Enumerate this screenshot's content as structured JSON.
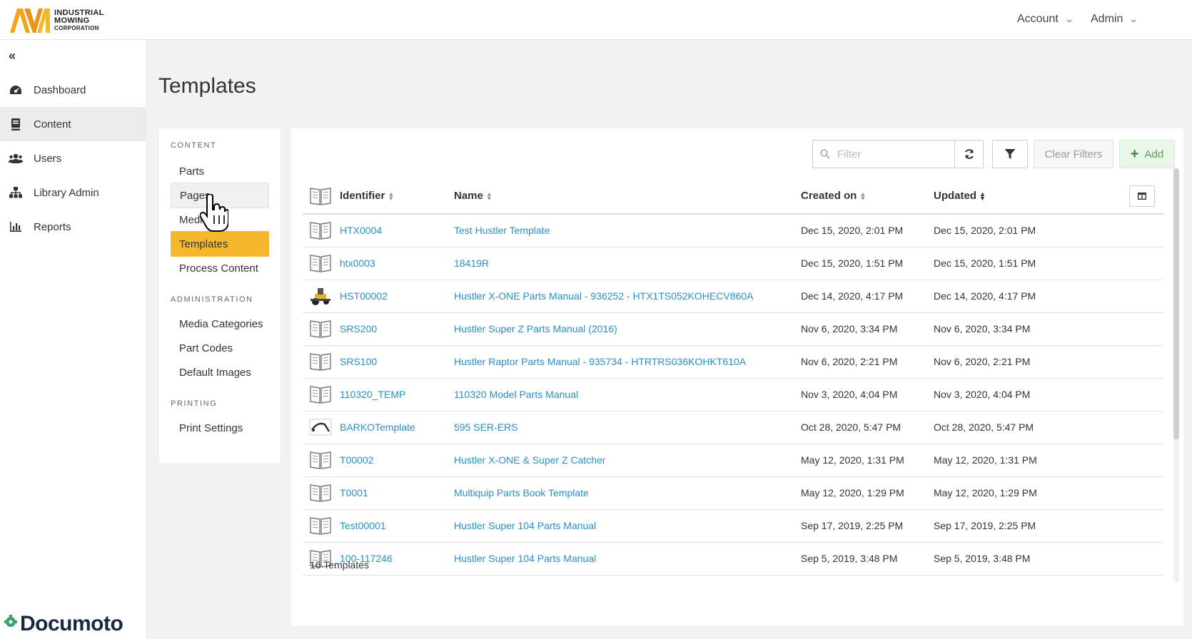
{
  "brand": {
    "company_line1": "INDUSTRIAL",
    "company_line2": "MOWING",
    "company_line3": "CORPORATION",
    "product": "Documoto",
    "accent_color": "#f5b82c",
    "link_color": "#2a8fc7"
  },
  "header": {
    "account_label": "Account",
    "admin_label": "Admin"
  },
  "leftnav": {
    "items": [
      {
        "label": "Dashboard",
        "icon": "dashboard-gauge-icon"
      },
      {
        "label": "Content",
        "icon": "book-icon",
        "active": true
      },
      {
        "label": "Users",
        "icon": "users-icon"
      },
      {
        "label": "Library Admin",
        "icon": "sitemap-icon"
      },
      {
        "label": "Reports",
        "icon": "bar-chart-icon"
      }
    ]
  },
  "page": {
    "title": "Templates"
  },
  "submenu": {
    "content_heading": "CONTENT",
    "content_items": [
      "Parts",
      "Pages",
      "Media",
      "Templates",
      "Process Content"
    ],
    "admin_heading": "ADMINISTRATION",
    "admin_items": [
      "Media Categories",
      "Part Codes",
      "Default Images"
    ],
    "printing_heading": "PRINTING",
    "printing_items": [
      "Print Settings"
    ],
    "active_item": "Templates",
    "hover_item": "Pages"
  },
  "toolbar": {
    "filter_placeholder": "Filter",
    "clear_filters_label": "Clear Filters",
    "add_label": "Add"
  },
  "table": {
    "columns": [
      "Identifier",
      "Name",
      "Created on",
      "Updated"
    ],
    "rows": [
      {
        "thumb": "book-icon",
        "identifier": "HTX0004",
        "name": "Test Hustler Template",
        "created": "Dec 15, 2020, 2:01 PM",
        "updated": "Dec 15, 2020, 2:01 PM"
      },
      {
        "thumb": "book-icon",
        "identifier": "htx0003",
        "name": "18419R",
        "created": "Dec 15, 2020, 1:51 PM",
        "updated": "Dec 15, 2020, 1:51 PM"
      },
      {
        "thumb": "mower-image",
        "identifier": "HST00002",
        "name": "Hustler X-ONE Parts Manual - 936252 - HTX1TS052KOHECV860A",
        "created": "Dec 14, 2020, 4:17 PM",
        "updated": "Dec 14, 2020, 4:17 PM"
      },
      {
        "thumb": "book-icon",
        "identifier": "SRS200",
        "name": "Hustler Super Z Parts Manual (2016)",
        "created": "Nov 6, 2020, 3:34 PM",
        "updated": "Nov 6, 2020, 3:34 PM"
      },
      {
        "thumb": "book-icon",
        "identifier": "SRS100",
        "name": "Hustler Raptor Parts Manual - 935734 - HTRTRS036KOHKT610A",
        "created": "Nov 6, 2020, 2:21 PM",
        "updated": "Nov 6, 2020, 2:21 PM"
      },
      {
        "thumb": "book-icon",
        "identifier": "110320_TEMP",
        "name": "110320 Model Parts Manual",
        "created": "Nov 3, 2020, 4:04 PM",
        "updated": "Nov 3, 2020, 4:04 PM"
      },
      {
        "thumb": "part-image",
        "identifier": "BARKOTemplate",
        "name": "595 SER-ERS",
        "created": "Oct 28, 2020, 5:47 PM",
        "updated": "Oct 28, 2020, 5:47 PM"
      },
      {
        "thumb": "book-icon",
        "identifier": "T00002",
        "name": "Hustler X-ONE & Super Z Catcher",
        "created": "May 12, 2020, 1:31 PM",
        "updated": "May 12, 2020, 1:31 PM"
      },
      {
        "thumb": "book-icon",
        "identifier": "T0001",
        "name": "Multiquip Parts Book Template",
        "created": "May 12, 2020, 1:29 PM",
        "updated": "May 12, 2020, 1:29 PM"
      },
      {
        "thumb": "book-icon",
        "identifier": "Test00001",
        "name": "Hustler Super 104 Parts Manual",
        "created": "Sep 17, 2019, 2:25 PM",
        "updated": "Sep 17, 2019, 2:25 PM"
      },
      {
        "thumb": "book-icon",
        "identifier": "100-117246",
        "name": "Hustler Super 104 Parts Manual",
        "created": "Sep 5, 2019, 3:48 PM",
        "updated": "Sep 5, 2019, 3:48 PM"
      }
    ],
    "footer_count": "16 Templates"
  }
}
